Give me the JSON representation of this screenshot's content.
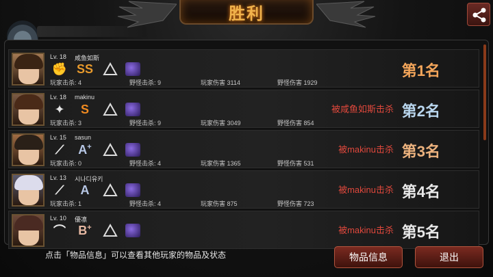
{
  "header": {
    "title": "胜利"
  },
  "players": [
    {
      "level": "Lv. 18",
      "name": "咸鱼如斯",
      "grade": "SS",
      "grade_plus": "",
      "grade_color": "#e89a2c",
      "player_kills": "玩家击杀: 4",
      "monster_kills": "野怪击杀: 9",
      "player_damage": "玩家伤害 3114",
      "monster_damage": "野怪伤害 1929",
      "killed_by": "",
      "rank": "第1名",
      "rank_color": "#f3a55a"
    },
    {
      "level": "Lv. 18",
      "name": "makinu",
      "grade": "S",
      "grade_plus": "",
      "grade_color": "#f08a20",
      "player_kills": "玩家击杀: 3",
      "monster_kills": "野怪击杀: 9",
      "player_damage": "玩家伤害 3049",
      "monster_damage": "野怪伤害 854",
      "killed_by": "被咸鱼如斯击杀",
      "rank": "第2名",
      "rank_color": "#b9d6ee"
    },
    {
      "level": "Lv. 15",
      "name": "sasun",
      "grade": "A",
      "grade_plus": "+",
      "grade_color": "#b8c8e6",
      "player_kills": "玩家击杀: 0",
      "monster_kills": "野怪击杀: 4",
      "player_damage": "玩家伤害 1365",
      "monster_damage": "野怪伤害 531",
      "killed_by": "被makinu击杀",
      "rank": "第3名",
      "rank_color": "#ecb27e"
    },
    {
      "level": "Lv. 13",
      "name": "시나디유키",
      "grade": "A",
      "grade_plus": "",
      "grade_color": "#b8c8e6",
      "player_kills": "玩家击杀: 1",
      "monster_kills": "野怪击杀: 4",
      "player_damage": "玩家伤害 875",
      "monster_damage": "野怪伤害 723",
      "killed_by": "被makinu击杀",
      "rank": "第4名",
      "rank_color": "#e8e8e8"
    },
    {
      "level": "Lv. 10",
      "name": "優凛",
      "grade": "B",
      "grade_plus": "+",
      "grade_color": "#e6b8a2",
      "player_kills": "",
      "monster_kills": "",
      "player_damage": "",
      "monster_damage": "",
      "killed_by": "被makinu击杀",
      "rank": "第5名",
      "rank_color": "#e8e8e8"
    }
  ],
  "footer": {
    "hint": "点击「物品信息」可以查看其他玩家的物品及状态",
    "item_info_button": "物品信息",
    "exit_button": "退出"
  }
}
